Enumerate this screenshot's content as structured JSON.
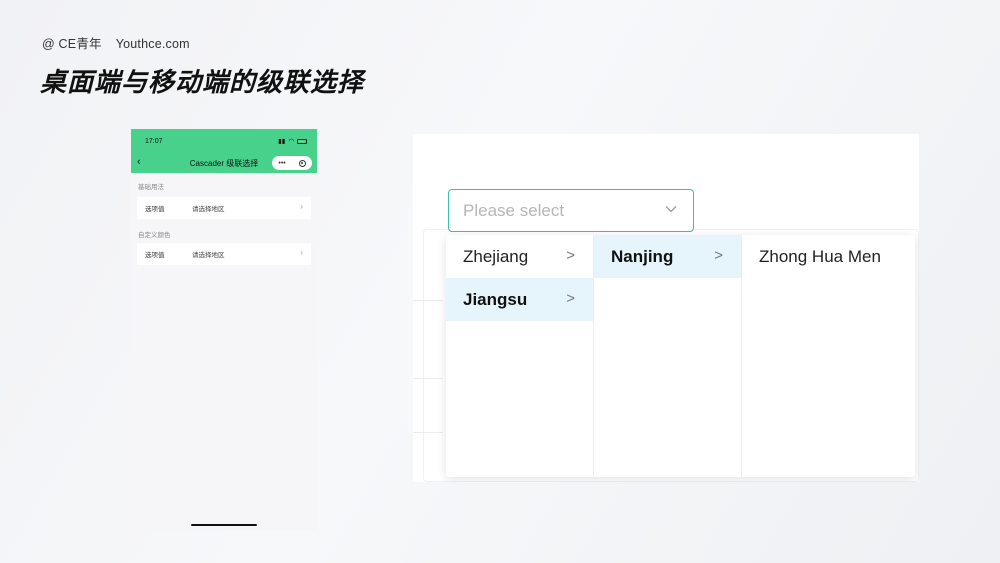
{
  "brand": {
    "handle": "@ CE青年",
    "site": "Youthce.com"
  },
  "headline": "桌面端与移动端的级联选择",
  "mobile": {
    "status_time": "17:07",
    "nav_title": "Cascader 级联选择",
    "capsule_dots": "•••",
    "sections": [
      {
        "label": "基础用法",
        "cell_label": "选项值",
        "cell_value": "请选择地区"
      },
      {
        "label": "自定义颜色",
        "cell_label": "选项值",
        "cell_value": "请选择地区"
      }
    ]
  },
  "desktop": {
    "placeholder": "Please select",
    "columns": [
      {
        "options": [
          "Zhejiang",
          "Jiangsu"
        ],
        "selected": "Jiangsu"
      },
      {
        "options": [
          "Nanjing"
        ],
        "selected": "Nanjing"
      },
      {
        "options": [
          "Zhong Hua Men"
        ],
        "selected": ""
      }
    ],
    "colors": {
      "accent_border": "#3dbfae",
      "selected_bg": "#e6f5fc",
      "mobile_header": "#48d18b"
    }
  }
}
